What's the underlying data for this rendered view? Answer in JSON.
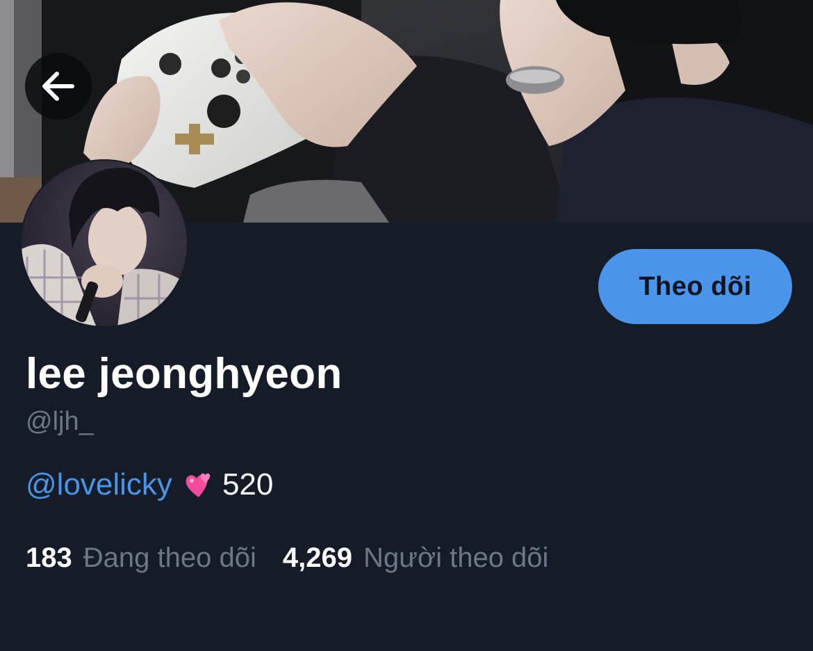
{
  "header": {
    "banner_icon": "header-photo",
    "back_icon": "arrow-left-icon"
  },
  "profile": {
    "display_name": "lee jeonghyeon",
    "handle": "@ljh_",
    "follow_label": "Theo dõi",
    "bio": {
      "mention": "@lovelicky",
      "emoji": "two-hearts-icon",
      "text": "520"
    },
    "stats": {
      "following_count": "183",
      "following_label": "Đang theo dõi",
      "followers_count": "4,269",
      "followers_label": "Người theo dõi"
    }
  },
  "colors": {
    "background": "#151c27",
    "accent": "#4a95ea",
    "muted_text": "#6c7886",
    "primary_text": "#ffffff"
  }
}
